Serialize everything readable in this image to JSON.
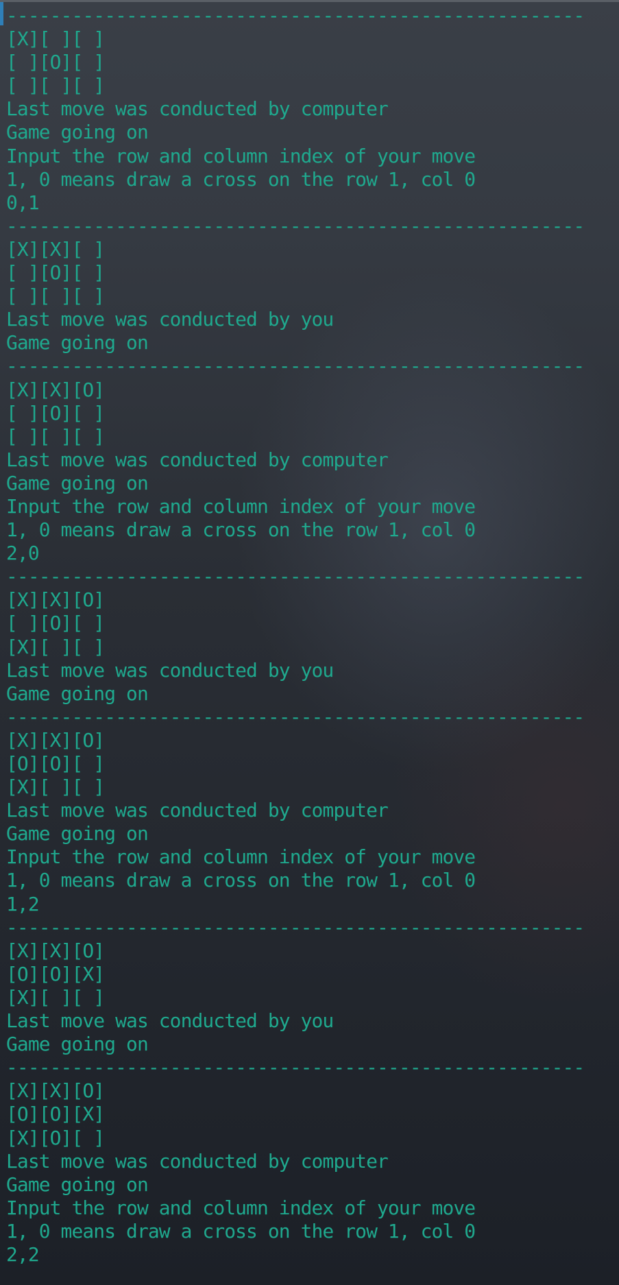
{
  "terminal": {
    "text_color": "#1fa98e",
    "lines": [
      "-----------------------------------------------------",
      "[X][ ][ ]",
      "[ ][O][ ]",
      "[ ][ ][ ]",
      "Last move was conducted by computer",
      "Game going on",
      "Input the row and column index of your move",
      "1, 0 means draw a cross on the row 1, col 0",
      "0,1",
      "-----------------------------------------------------",
      "[X][X][ ]",
      "[ ][O][ ]",
      "[ ][ ][ ]",
      "Last move was conducted by you",
      "Game going on",
      "-----------------------------------------------------",
      "[X][X][O]",
      "[ ][O][ ]",
      "[ ][ ][ ]",
      "Last move was conducted by computer",
      "Game going on",
      "Input the row and column index of your move",
      "1, 0 means draw a cross on the row 1, col 0",
      "2,0",
      "-----------------------------------------------------",
      "[X][X][O]",
      "[ ][O][ ]",
      "[X][ ][ ]",
      "Last move was conducted by you",
      "Game going on",
      "-----------------------------------------------------",
      "[X][X][O]",
      "[O][O][ ]",
      "[X][ ][ ]",
      "Last move was conducted by computer",
      "Game going on",
      "Input the row and column index of your move",
      "1, 0 means draw a cross on the row 1, col 0",
      "1,2",
      "-----------------------------------------------------",
      "[X][X][O]",
      "[O][O][X]",
      "[X][ ][ ]",
      "Last move was conducted by you",
      "Game going on",
      "-----------------------------------------------------",
      "[X][X][O]",
      "[O][O][X]",
      "[X][O][ ]",
      "Last move was conducted by computer",
      "Game going on",
      "Input the row and column index of your move",
      "1, 0 means draw a cross on the row 1, col 0",
      "2,2"
    ]
  }
}
